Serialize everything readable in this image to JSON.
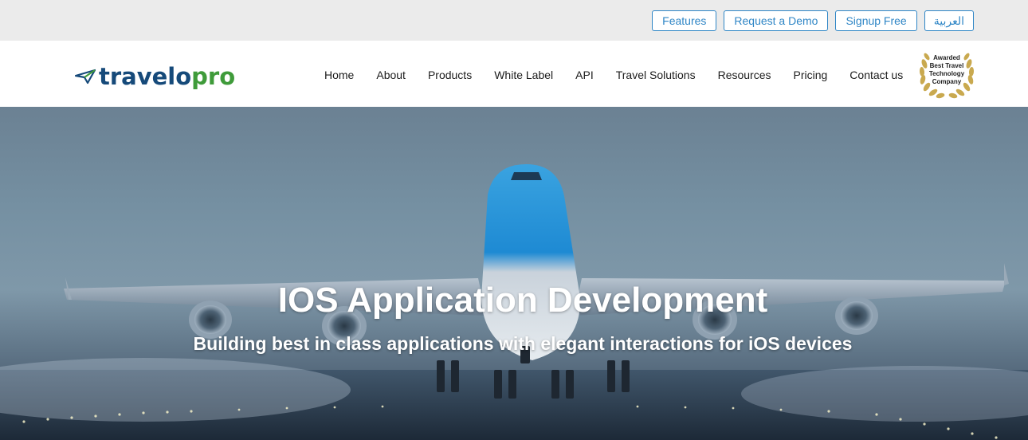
{
  "topbar": {
    "buttons": [
      {
        "label": "Features"
      },
      {
        "label": "Request a Demo"
      },
      {
        "label": "Signup Free"
      },
      {
        "label": "العربية"
      }
    ]
  },
  "header": {
    "logo": {
      "part1": "travelo",
      "part2": "pro",
      "icon": "paper-plane-icon"
    },
    "nav": [
      {
        "label": "Home"
      },
      {
        "label": "About"
      },
      {
        "label": "Products"
      },
      {
        "label": "White Label"
      },
      {
        "label": "API"
      },
      {
        "label": "Travel Solutions"
      },
      {
        "label": "Resources"
      },
      {
        "label": "Pricing"
      },
      {
        "label": "Contact us"
      }
    ],
    "award": {
      "line1": "Awarded",
      "line2": "Best Travel",
      "line3": "Technology",
      "line4": "Company",
      "icon": "laurel-wreath-icon"
    }
  },
  "hero": {
    "title": "IOS Application Development",
    "subtitle": "Building best in class applications with elegant interactions for iOS devices"
  },
  "colors": {
    "accent": "#2f86c6",
    "logo_dark": "#164a7a",
    "logo_green": "#3f9b3a",
    "topbar_bg": "#ebebeb"
  }
}
